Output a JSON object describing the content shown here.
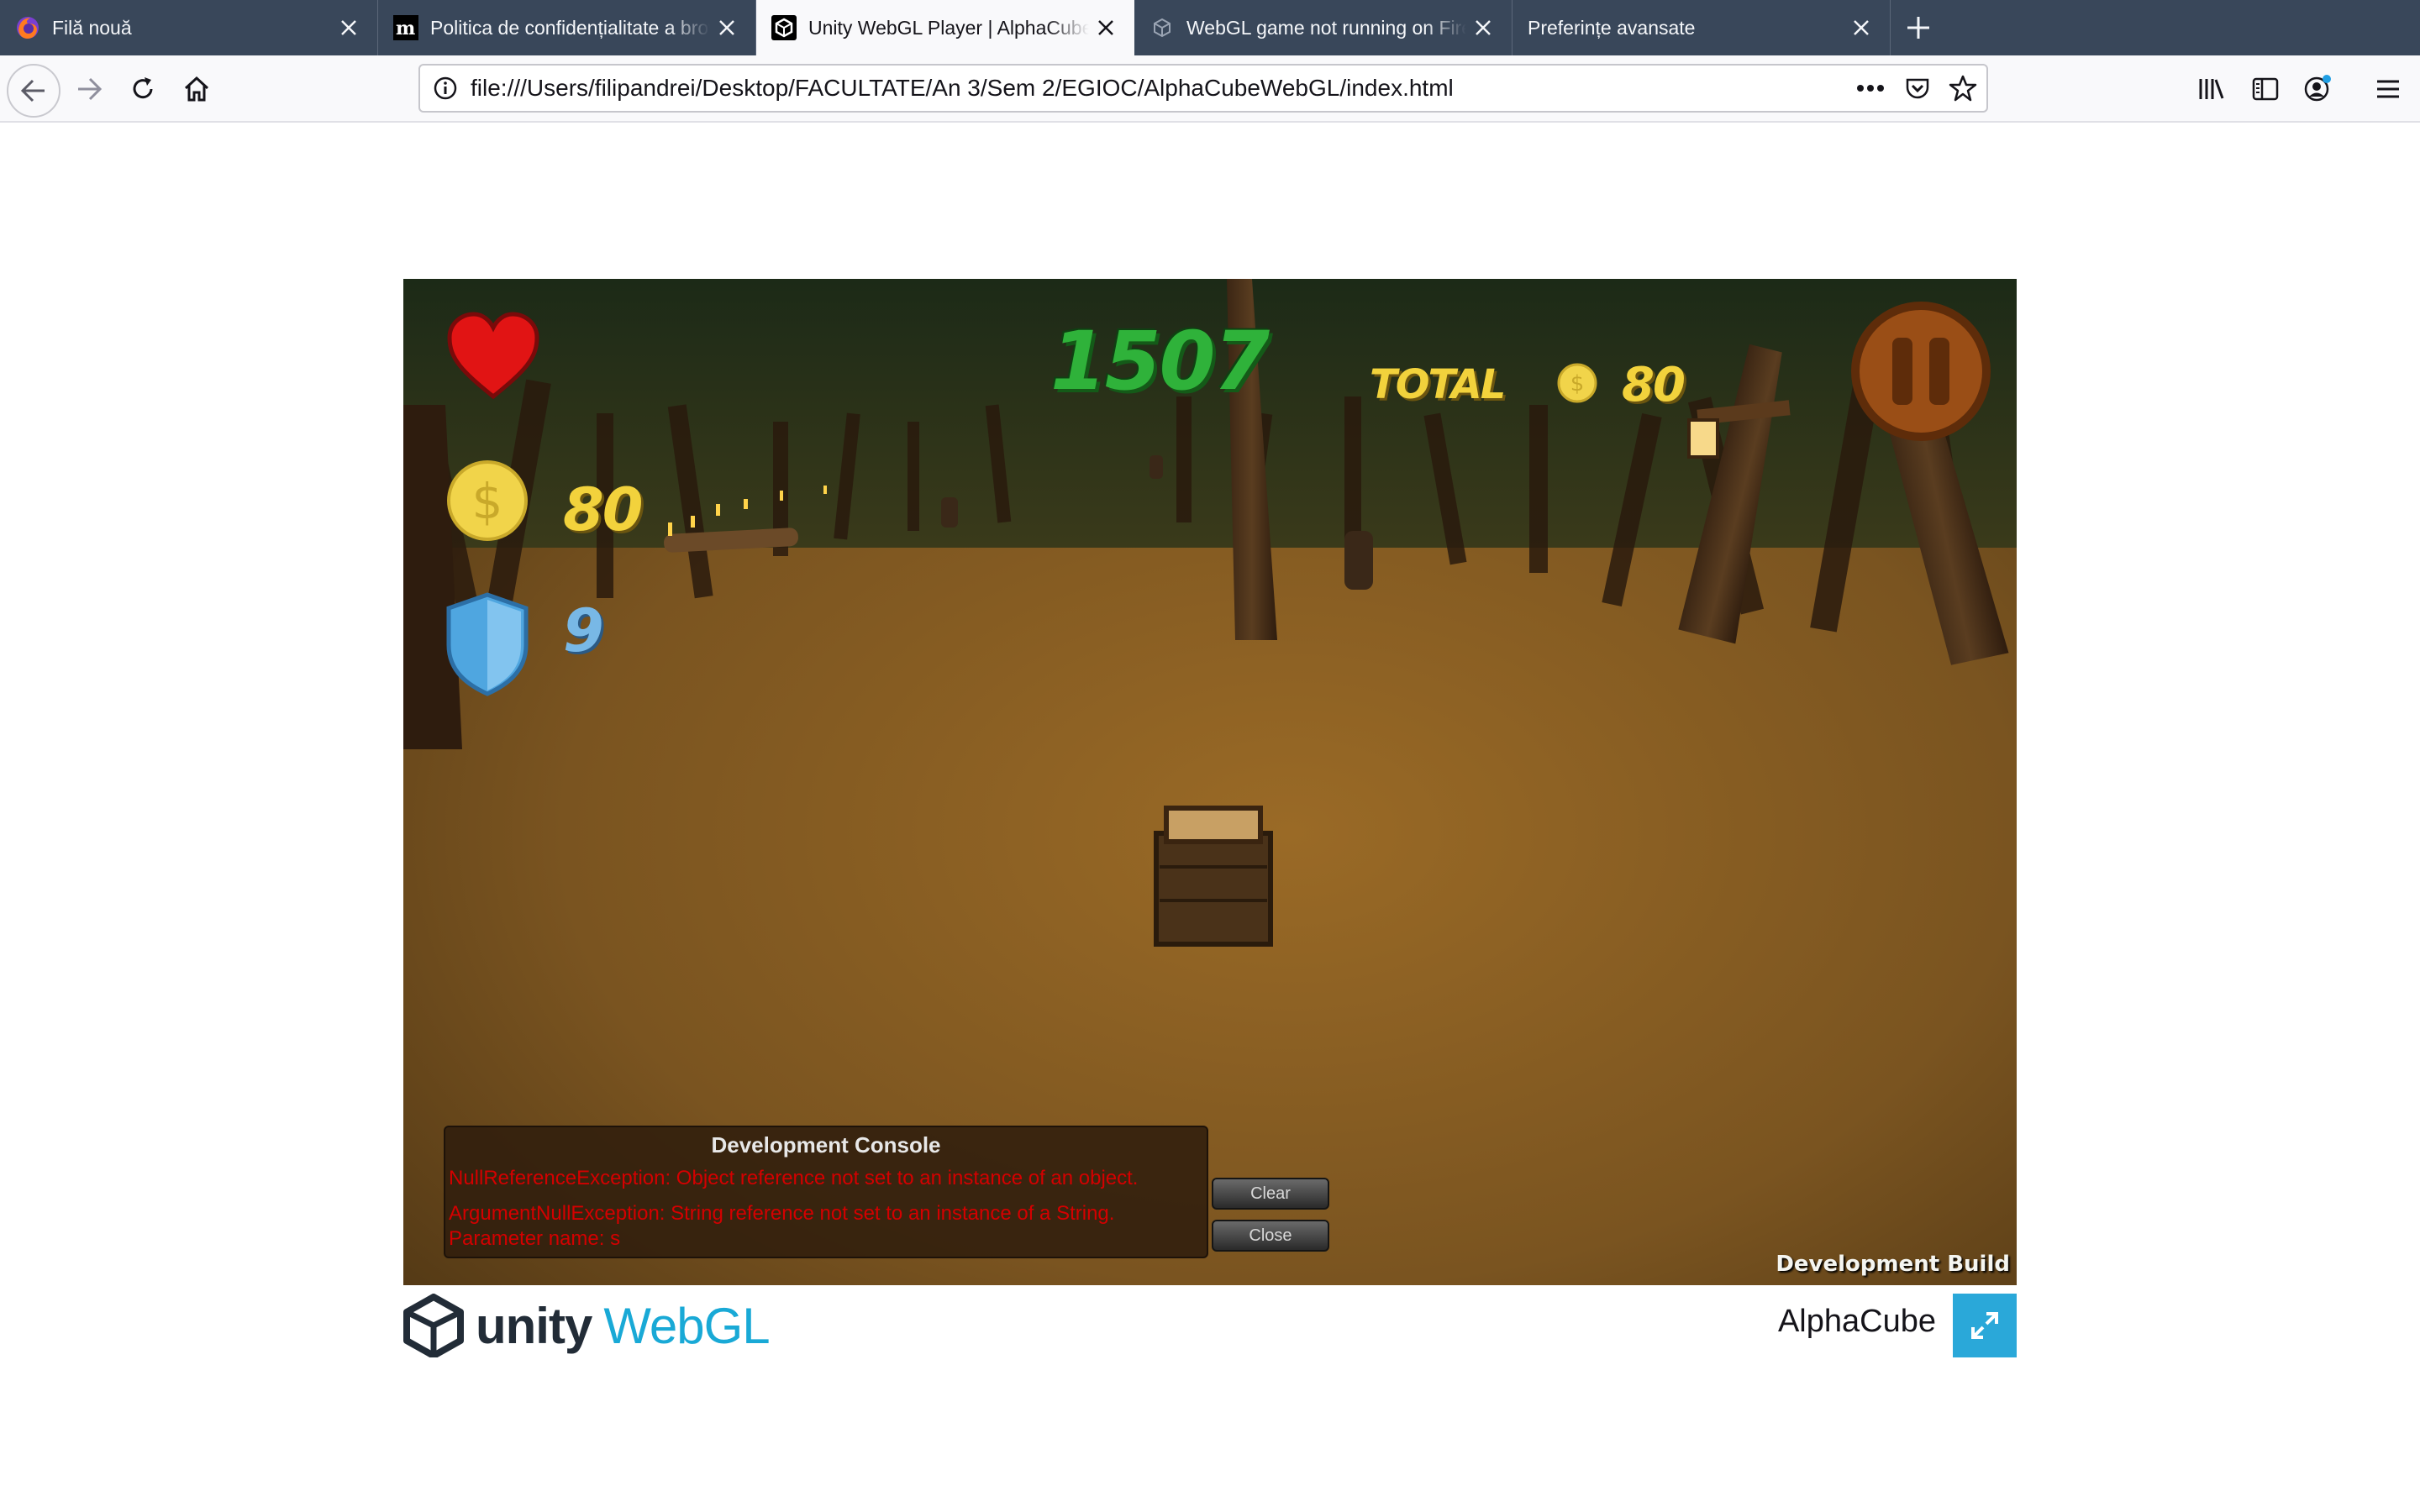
{
  "browser": {
    "tabs": [
      {
        "title": "Filă nouă",
        "favicon": "firefox-icon",
        "active": false
      },
      {
        "title": "Politica de confidențialitate a browserului",
        "favicon": "medium-icon",
        "active": false
      },
      {
        "title": "Unity WebGL Player | AlphaCube",
        "favicon": "unity-icon",
        "active": true
      },
      {
        "title": "WebGL game not running on Firefox",
        "favicon": "unity-outline-icon",
        "active": false
      },
      {
        "title": "Preferințe avansate",
        "favicon": "",
        "active": false
      }
    ],
    "url": "file:///Users/filipandrei/Desktop/FACULTATE/An 3/Sem 2/EGIOC/AlphaCubeWebGL/index.html",
    "accent_color": "#39475a"
  },
  "game": {
    "score": "1507",
    "total_label": "TOTAL",
    "total_coins": "80",
    "coins": "80",
    "shields": "9",
    "lives": 1,
    "dev_build_label": "Development Build",
    "console": {
      "title": "Development Console",
      "lines": [
        "NullReferenceException: Object reference not set to an instance of an object.",
        "ArgumentNullException: String reference not set to an instance of a String.",
        "Parameter name: s"
      ],
      "clear_label": "Clear",
      "close_label": "Close"
    }
  },
  "footer": {
    "unity_label": "unity",
    "webgl_label": "WebGL",
    "game_title": "AlphaCube"
  }
}
